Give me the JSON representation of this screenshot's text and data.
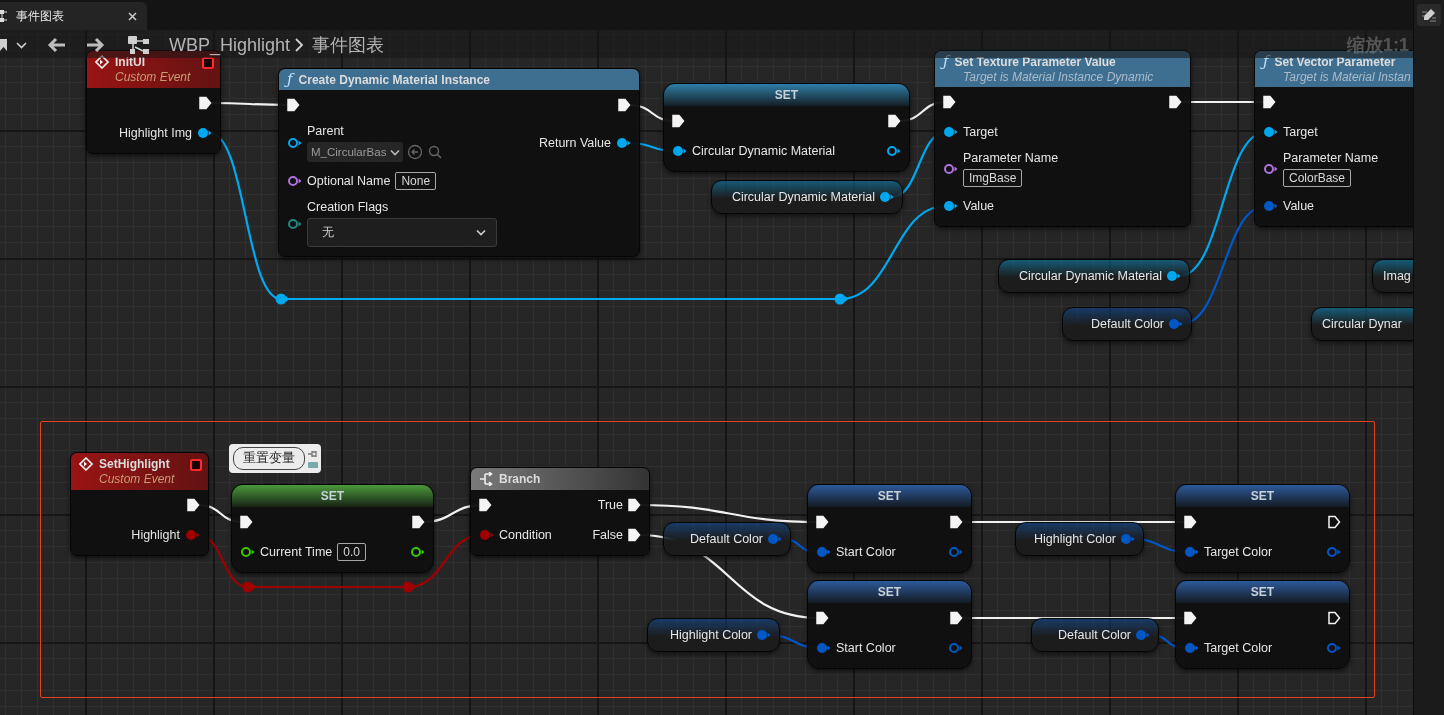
{
  "tab": {
    "label": "事件图表"
  },
  "toolbar": {
    "breadcrumb": [
      "WBP_Highlight",
      "事件图表"
    ],
    "zoom": "缩放1:1"
  },
  "nodes": [
    {
      "kind": "event",
      "title": "InitUI",
      "subtitle": "Custom Event",
      "color": "#9a1414",
      "rows": [
        {
          "right": {
            "kind": "exec",
            "connected": true
          }
        },
        {
          "right": {
            "kind": "data",
            "label": "Highlight Img",
            "color": "#00a8f0",
            "connected": true
          }
        }
      ]
    },
    {
      "kind": "function",
      "icon": "ƒ",
      "title": "Create Dynamic Material Instance",
      "color": "#3f6f90",
      "rows": [
        {
          "left": {
            "kind": "exec",
            "connected": true
          },
          "right": {
            "kind": "exec",
            "connected": true
          }
        },
        {
          "left": {
            "kind": "data",
            "label": "Parent",
            "color": "#00a8f0",
            "connected": false,
            "field": {
              "kind": "asset",
              "value": "M_CircularBas"
            }
          },
          "right": {
            "kind": "data",
            "label": "Return Value",
            "color": "#00a8f0",
            "connected": true
          }
        },
        {
          "left": {
            "kind": "data",
            "label": "Optional Name",
            "color": "#b070e0",
            "connected": false,
            "field": {
              "kind": "text",
              "value": "None"
            }
          }
        },
        {
          "left": {
            "kind": "data",
            "label": "Creation Flags",
            "color": "#1f8a7e",
            "connected": false,
            "field": {
              "kind": "dropdown",
              "value": "无"
            }
          }
        }
      ]
    },
    {
      "kind": "set",
      "title": "SET",
      "color": "#2f7ea8",
      "rows": [
        {
          "left": {
            "kind": "exec",
            "connected": true
          },
          "right": {
            "kind": "exec",
            "connected": true
          }
        },
        {
          "left": {
            "kind": "data",
            "label": "Circular Dynamic Material",
            "color": "#00a8f0",
            "connected": true
          },
          "right": {
            "kind": "data",
            "color": "#00a8f0",
            "connected": false
          }
        }
      ]
    },
    {
      "kind": "getter",
      "label": "Circular Dynamic Material",
      "pin": {
        "color": "#00a8f0",
        "connected": true
      }
    },
    {
      "kind": "function",
      "icon": "ƒ",
      "title": "Set Texture Parameter Value",
      "subtitle": "Target is Material Instance Dynamic",
      "color": "#3f6f90",
      "rows": [
        {
          "left": {
            "kind": "exec",
            "connected": true
          },
          "right": {
            "kind": "exec",
            "connected": true
          }
        },
        {
          "left": {
            "kind": "data",
            "label": "Target",
            "color": "#00a8f0",
            "connected": true
          }
        },
        {
          "left": {
            "kind": "data",
            "label": "Parameter Name",
            "color": "#b070e0",
            "connected": false,
            "field": {
              "kind": "text",
              "value": "ImgBase"
            }
          }
        },
        {
          "left": {
            "kind": "data",
            "label": "Value",
            "color": "#00a8f0",
            "connected": true
          }
        }
      ]
    },
    {
      "kind": "function",
      "icon": "ƒ",
      "title": "Set Vector Parameter",
      "subtitle": "Target is Material Instan",
      "color": "#3f6f90",
      "rows": [
        {
          "left": {
            "kind": "exec",
            "connected": true
          }
        },
        {
          "left": {
            "kind": "data",
            "label": "Target",
            "color": "#00a8f0",
            "connected": true
          }
        },
        {
          "left": {
            "kind": "data",
            "label": "Parameter Name",
            "color": "#b070e0",
            "connected": false,
            "field": {
              "kind": "text",
              "value": "ColorBase"
            }
          }
        },
        {
          "left": {
            "kind": "data",
            "label": "Value",
            "color": "#0058c8",
            "connected": true
          }
        }
      ]
    },
    {
      "kind": "getter",
      "label": "Circular Dynamic Material",
      "pin": {
        "color": "#00a8f0",
        "connected": true
      }
    },
    {
      "kind": "getter",
      "label": "Default Color",
      "pin": {
        "color": "#0058c8",
        "connected": true
      }
    },
    {
      "kind": "getter",
      "label": "Imag"
    },
    {
      "kind": "getter",
      "label": "Circular Dynar"
    },
    {
      "kind": "event",
      "title": "SetHighlight",
      "subtitle": "Custom Event",
      "color": "#9a1414",
      "rows": [
        {
          "right": {
            "kind": "exec",
            "connected": true
          }
        },
        {
          "right": {
            "kind": "data",
            "label": "Highlight",
            "color": "#a00000",
            "connected": true
          }
        }
      ]
    },
    {
      "kind": "set",
      "title": "SET",
      "color": "#4a9a3a",
      "comment": "重置变量",
      "rows": [
        {
          "left": {
            "kind": "exec",
            "connected": true
          },
          "right": {
            "kind": "exec",
            "connected": true
          }
        },
        {
          "left": {
            "kind": "data",
            "label": "Current Time",
            "color": "#38c800",
            "connected": false,
            "field": {
              "kind": "text",
              "value": "0.0"
            }
          },
          "right": {
            "kind": "data",
            "color": "#38c800",
            "connected": false
          }
        }
      ]
    },
    {
      "kind": "branch",
      "title": "Branch",
      "color": "#7a7a7a",
      "rows": [
        {
          "left": {
            "kind": "exec",
            "connected": true
          },
          "right": {
            "kind": "exec",
            "label": "True",
            "connected": true
          }
        },
        {
          "left": {
            "kind": "data",
            "label": "Condition",
            "color": "#a00000",
            "connected": true
          },
          "right": {
            "kind": "exec",
            "label": "False",
            "connected": true
          }
        }
      ]
    },
    {
      "kind": "set",
      "title": "SET",
      "color": "#2d5a9a",
      "rows": [
        {
          "left": {
            "kind": "exec",
            "connected": true
          },
          "right": {
            "kind": "exec",
            "connected": true
          }
        },
        {
          "left": {
            "kind": "data",
            "label": "Start Color",
            "color": "#0058c8",
            "connected": true
          },
          "right": {
            "kind": "data",
            "color": "#0058c8",
            "connected": false
          }
        }
      ]
    },
    {
      "kind": "getter",
      "label": "Default Color",
      "pin": {
        "color": "#0058c8",
        "connected": true
      }
    },
    {
      "kind": "getter",
      "label": "Highlight Color",
      "pin": {
        "color": "#0058c8",
        "connected": true
      }
    },
    {
      "kind": "set",
      "title": "SET",
      "color": "#2d5a9a",
      "rows": [
        {
          "left": {
            "kind": "exec",
            "connected": true
          },
          "right": {
            "kind": "exec",
            "connected": false
          }
        },
        {
          "left": {
            "kind": "data",
            "label": "Target Color",
            "color": "#0058c8",
            "connected": true
          },
          "right": {
            "kind": "data",
            "color": "#0058c8",
            "connected": false
          }
        }
      ]
    },
    {
      "kind": "set",
      "title": "SET",
      "color": "#2d5a9a",
      "rows": [
        {
          "left": {
            "kind": "exec",
            "connected": true
          },
          "right": {
            "kind": "exec",
            "connected": true
          }
        },
        {
          "left": {
            "kind": "data",
            "label": "Start Color",
            "color": "#0058c8",
            "connected": true
          },
          "right": {
            "kind": "data",
            "color": "#0058c8",
            "connected": false
          }
        }
      ]
    },
    {
      "kind": "getter",
      "label": "Highlight Color",
      "pin": {
        "color": "#0058c8",
        "connected": true
      }
    },
    {
      "kind": "getter",
      "label": "Default Color",
      "pin": {
        "color": "#0058c8",
        "connected": true
      }
    },
    {
      "kind": "set",
      "title": "SET",
      "color": "#2d5a9a",
      "rows": [
        {
          "left": {
            "kind": "exec",
            "connected": true
          },
          "right": {
            "kind": "exec",
            "connected": false
          }
        },
        {
          "left": {
            "kind": "data",
            "label": "Target Color",
            "color": "#0058c8",
            "connected": true
          },
          "right": {
            "kind": "data",
            "color": "#0058c8",
            "connected": false
          }
        }
      ]
    }
  ]
}
